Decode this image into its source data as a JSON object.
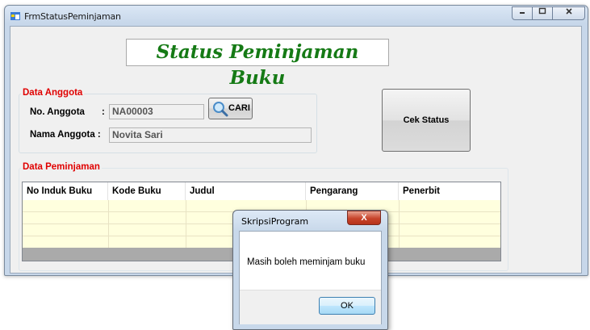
{
  "window": {
    "title": "FrmStatusPeminjaman",
    "icon": "form-icon"
  },
  "heading": "Status Peminjaman Buku",
  "anggota": {
    "group_label": "Data Anggota",
    "no_label": "No. Anggota",
    "colon": ":",
    "no_value": "NA00003",
    "cari_label": "CARI",
    "nama_label": "Nama Anggota :",
    "nama_value": "Novita Sari"
  },
  "cek_status_label": "Cek Status",
  "peminjaman": {
    "group_label": "Data Peminjaman",
    "columns": [
      "No Induk Buku",
      "Kode Buku",
      "Judul",
      "Pengarang",
      "Penerbit"
    ]
  },
  "dialog": {
    "title": "SkripsiProgram",
    "close_glyph": "X",
    "message": "Masih boleh meminjam buku",
    "ok_label": "OK"
  },
  "colors": {
    "heading_text": "#157a15",
    "group_label": "#e00000",
    "grid_row": "#ffffde"
  }
}
